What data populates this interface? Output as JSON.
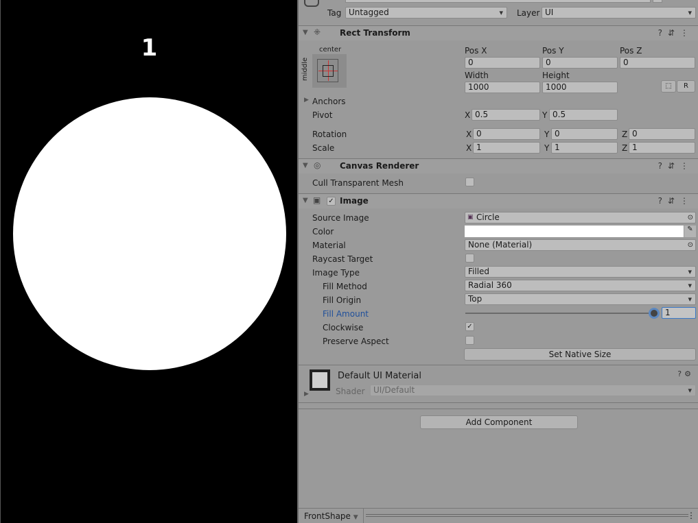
{
  "game": {
    "label": "1"
  },
  "header": {
    "tag_label": "Tag",
    "tag_value": "Untagged",
    "layer_label": "Layer",
    "layer_value": "UI"
  },
  "rect_transform": {
    "title": "Rect Transform",
    "anchor_h": "center",
    "anchor_v": "middle",
    "pos_x_label": "Pos X",
    "pos_y_label": "Pos Y",
    "pos_z_label": "Pos Z",
    "pos_x": "0",
    "pos_y": "0",
    "pos_z": "0",
    "width_label": "Width",
    "height_label": "Height",
    "width": "1000",
    "height": "1000",
    "raw_button": "R",
    "anchors_label": "Anchors",
    "pivot_label": "Pivot",
    "pivot_x": "0.5",
    "pivot_y": "0.5",
    "rotation_label": "Rotation",
    "rot_x": "0",
    "rot_y": "0",
    "rot_z": "0",
    "scale_label": "Scale",
    "scale_x": "1",
    "scale_y": "1",
    "scale_z": "1",
    "x": "X",
    "y": "Y",
    "z": "Z"
  },
  "canvas_renderer": {
    "title": "Canvas Renderer",
    "cull_label": "Cull Transparent Mesh",
    "cull": false
  },
  "image": {
    "title": "Image",
    "enabled": true,
    "source_image_label": "Source Image",
    "source_image": "Circle",
    "color_label": "Color",
    "color": "#ffffff",
    "material_label": "Material",
    "material": "None (Material)",
    "raycast_label": "Raycast Target",
    "raycast": false,
    "image_type_label": "Image Type",
    "image_type": "Filled",
    "fill_method_label": "Fill Method",
    "fill_method": "Radial 360",
    "fill_origin_label": "Fill Origin",
    "fill_origin": "Top",
    "fill_amount_label": "Fill Amount",
    "fill_amount": "1",
    "clockwise_label": "Clockwise",
    "clockwise": true,
    "preserve_label": "Preserve Aspect",
    "preserve": false,
    "native_size_button": "Set Native Size"
  },
  "material": {
    "title": "Default UI Material",
    "shader_label": "Shader",
    "shader": "UI/Default"
  },
  "add_component": "Add Component",
  "footer": {
    "object_name": "FrontShape"
  }
}
